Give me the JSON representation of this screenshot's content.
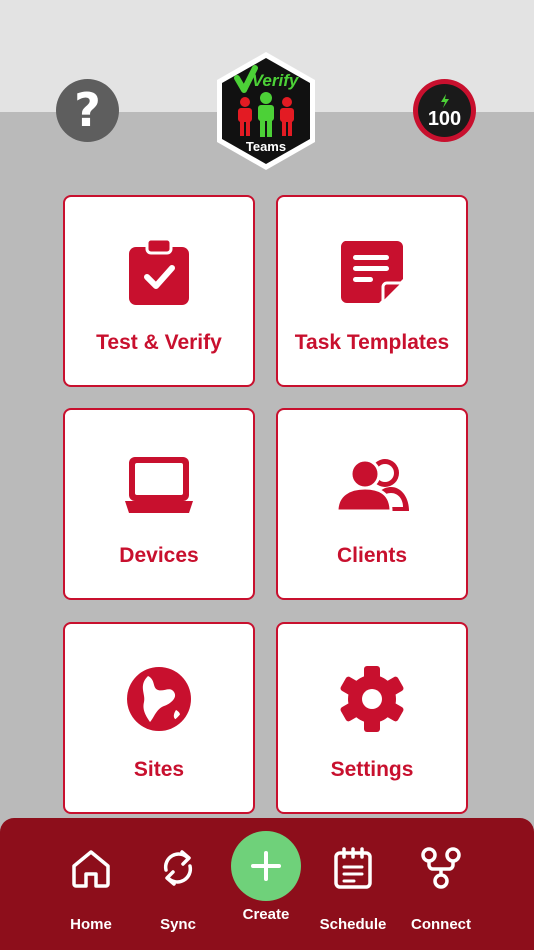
{
  "header": {
    "help_glyph": "?",
    "logo": {
      "top_text": "Verify",
      "bottom_text": "Teams"
    },
    "score": "100"
  },
  "tiles": [
    {
      "label": "Test & Verify",
      "icon": "clipboard-check-icon"
    },
    {
      "label": "Task Templates",
      "icon": "document-template-icon"
    },
    {
      "label": "Devices",
      "icon": "laptop-icon"
    },
    {
      "label": "Clients",
      "icon": "users-icon"
    },
    {
      "label": "Sites",
      "icon": "globe-icon"
    },
    {
      "label": "Settings",
      "icon": "gear-icon"
    }
  ],
  "tabbar": {
    "items": [
      {
        "label": "Home",
        "icon": "home-icon"
      },
      {
        "label": "Sync",
        "icon": "sync-icon"
      },
      {
        "label": "Create",
        "icon": "plus-icon"
      },
      {
        "label": "Schedule",
        "icon": "schedule-icon"
      },
      {
        "label": "Connect",
        "icon": "connect-icon"
      }
    ]
  },
  "colors": {
    "brand_red": "#c8102e",
    "tabbar_bg": "#8d0e1b",
    "create_green": "#6fd17a",
    "background": "#bababa"
  }
}
